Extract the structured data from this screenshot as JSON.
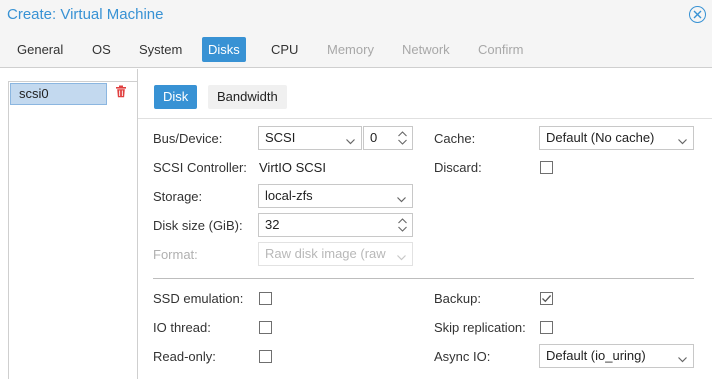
{
  "window": {
    "title": "Create: Virtual Machine",
    "close_icon": "close-icon"
  },
  "wizard_tabs": [
    {
      "label": "General",
      "state": "normal"
    },
    {
      "label": "OS",
      "state": "normal"
    },
    {
      "label": "System",
      "state": "normal"
    },
    {
      "label": "Disks",
      "state": "active"
    },
    {
      "label": "CPU",
      "state": "normal"
    },
    {
      "label": "Memory",
      "state": "disabled"
    },
    {
      "label": "Network",
      "state": "disabled"
    },
    {
      "label": "Confirm",
      "state": "disabled"
    }
  ],
  "disk_list": {
    "items": [
      {
        "label": "scsi0",
        "selected": true
      }
    ],
    "delete_icon": "trash-icon"
  },
  "sub_tabs": [
    {
      "label": "Disk",
      "active": true
    },
    {
      "label": "Bandwidth",
      "active": false
    }
  ],
  "form": {
    "bus_device": {
      "label": "Bus/Device:",
      "bus": "SCSI",
      "device": "0"
    },
    "scsi_controller": {
      "label": "SCSI Controller:",
      "value": "VirtIO SCSI"
    },
    "storage": {
      "label": "Storage:",
      "value": "local-zfs"
    },
    "disk_size": {
      "label": "Disk size (GiB):",
      "value": "32"
    },
    "format": {
      "label": "Format:",
      "value": "Raw disk image (raw",
      "disabled": true
    },
    "cache": {
      "label": "Cache:",
      "value": "Default (No cache)"
    },
    "discard": {
      "label": "Discard:",
      "checked": false
    },
    "ssd_emulation": {
      "label": "SSD emulation:",
      "checked": false
    },
    "io_thread": {
      "label": "IO thread:",
      "checked": false
    },
    "read_only": {
      "label": "Read-only:",
      "checked": false
    },
    "backup": {
      "label": "Backup:",
      "checked": true
    },
    "skip_replication": {
      "label": "Skip replication:",
      "checked": false
    },
    "async_io": {
      "label": "Async IO:",
      "value": "Default (io_uring)"
    }
  },
  "colors": {
    "accent": "#3892d4",
    "selected_row": "#c3d9ef",
    "delete": "#e04040",
    "disabled_text": "#a8a8a8"
  }
}
